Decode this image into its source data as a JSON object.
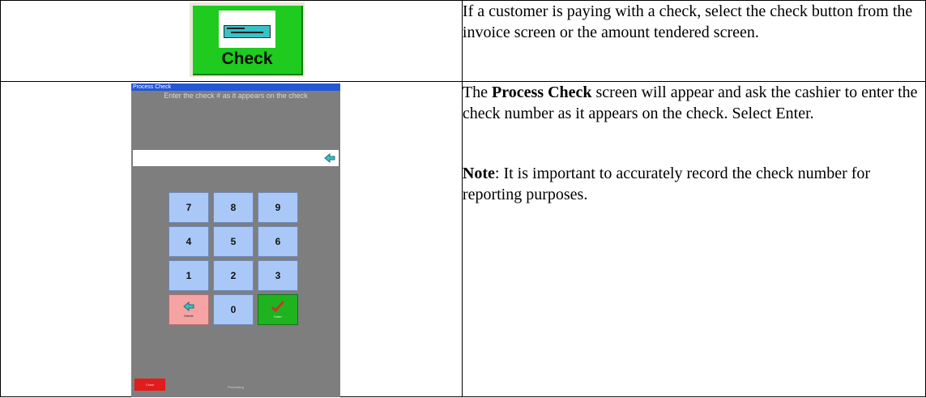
{
  "rows": [
    {
      "image": {
        "button_label": "Check",
        "icon": "cheque-icon",
        "colors": {
          "face": "#1ecb1e",
          "frame": "#eae7d8",
          "cheque": "#38c1c9"
        }
      },
      "text": "If a customer is paying with a check, select the check button from the invoice screen or the amount tendered screen."
    },
    {
      "image": {
        "window_title": "Process Check",
        "prompt": "Enter the check # as it appears on the check",
        "entry_value": "",
        "keypad": [
          "7",
          "8",
          "9",
          "4",
          "5",
          "6",
          "1",
          "2",
          "3"
        ],
        "delete_label": "Delete",
        "zero_label": "0",
        "enter_label": "Enter",
        "close_label": "Close",
        "status_text": "Processing",
        "colors": {
          "background": "#7e7e7e",
          "key": "#a9c8f7",
          "delete": "#f5a3a3",
          "enter": "#1fb31f",
          "close": "#e21b1b"
        }
      },
      "text_intro_bold": "Process Check",
      "text_intro_rest": " screen will appear and ask the cashier to enter the check number as it appears on the check. Select Enter.",
      "text_intro_prefix": "The ",
      "note_label": "Note",
      "note_text": ":  It is important to accurately record the check number for reporting purposes."
    }
  ]
}
